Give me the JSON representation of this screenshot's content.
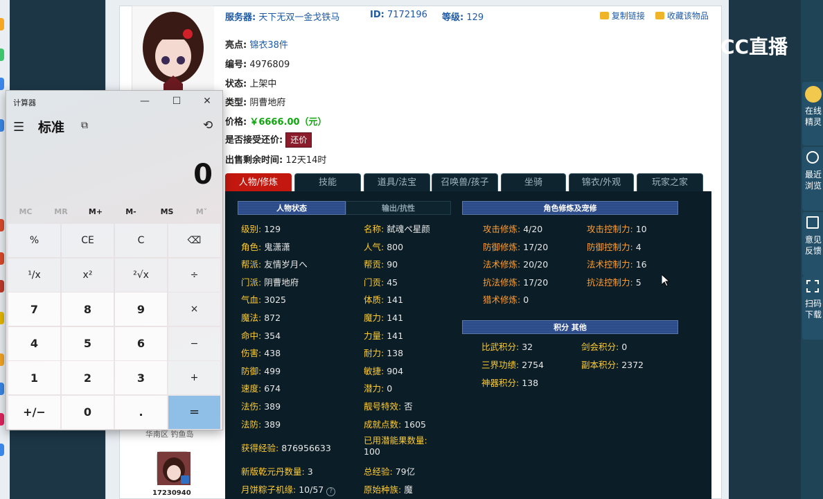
{
  "calculator": {
    "title": "计算器",
    "mode": "标准",
    "display": "0",
    "memory": [
      "MC",
      "MR",
      "M+",
      "M-",
      "MS",
      "M˅"
    ],
    "keys": [
      [
        "%",
        "CE",
        "C",
        "⌫"
      ],
      [
        "¹/x",
        "x²",
        "²√x",
        "÷"
      ],
      [
        "7",
        "8",
        "9",
        "×"
      ],
      [
        "4",
        "5",
        "6",
        "−"
      ],
      [
        "1",
        "2",
        "3",
        "+"
      ],
      [
        "+/−",
        "0",
        ".",
        "="
      ]
    ]
  },
  "info": {
    "server_label": "服务器:",
    "server_value": "天下无双一金戈铁马",
    "id_label": "ID:",
    "id_value": "7172196",
    "level_label": "等级:",
    "level_value": "129",
    "copy_link": "复制链接",
    "favorite": "收藏该物品",
    "highlight_label": "亮点:",
    "highlight_value": "锦衣38件",
    "number_label": "编号:",
    "number_value": "4976809",
    "status_label": "状态:",
    "status_value": "上架中",
    "type_label": "类型:",
    "type_value": "阴曹地府",
    "price_label": "价格:",
    "price_value": "￥6666.00（元）",
    "bargain_label": "是否接受还价:",
    "bargain_button": "还价",
    "remaining_label": "出售剩余时间:",
    "remaining_value": "12天14时"
  },
  "tabs": [
    "人物/修炼",
    "技能",
    "道具/法宝",
    "召唤兽/孩子",
    "坐骑",
    "锦衣/外观",
    "玩家之家"
  ],
  "headers": {
    "status": "人物状态",
    "output": "输出/抗性",
    "cultivation": "角色修炼及宠修",
    "points": "积分 其他"
  },
  "stats_left": [
    [
      "级别:",
      "129"
    ],
    [
      "角色:",
      "鬼潇潇"
    ],
    [
      "帮派:",
      "友情岁月へ"
    ],
    [
      "门派:",
      "阴曹地府"
    ],
    [
      "气血:",
      "3025"
    ],
    [
      "魔法:",
      "872"
    ],
    [
      "命中:",
      "354"
    ],
    [
      "伤害:",
      "438"
    ],
    [
      "防御:",
      "499"
    ],
    [
      "速度:",
      "674"
    ],
    [
      "法伤:",
      "389"
    ],
    [
      "法防:",
      "389"
    ]
  ],
  "stats_mid": [
    [
      "名称:",
      "弑魂ペ星颜"
    ],
    [
      "人气:",
      "800"
    ],
    [
      "帮贡:",
      "90"
    ],
    [
      "门贡:",
      "45"
    ],
    [
      "体质:",
      "141"
    ],
    [
      "魔力:",
      "141"
    ],
    [
      "力量:",
      "141"
    ],
    [
      "耐力:",
      "138"
    ],
    [
      "敏捷:",
      "904"
    ],
    [
      "潜力:",
      "0"
    ],
    [
      "靓号特效:",
      "否"
    ],
    [
      "成就点数:",
      "1605"
    ]
  ],
  "stats_bottom": {
    "exp_label": "获得经验:",
    "exp_value": "876956633",
    "used_fruit_label": "已用潜能果数量:",
    "used_fruit_value": "100",
    "pill_label": "新版乾元丹数量:",
    "pill_value": "3",
    "total_exp_label": "总经验:",
    "total_exp_value": "79亿",
    "zongzi_label": "月饼粽子机缘:",
    "zongzi_value": "10/57",
    "race_label": "原始种族:",
    "race_value": "魔"
  },
  "cultivation": [
    [
      "攻击修炼:",
      "4/20",
      "攻击控制力:",
      "10"
    ],
    [
      "防御修炼:",
      "17/20",
      "防御控制力:",
      "4"
    ],
    [
      "法术修炼:",
      "20/20",
      "法术控制力:",
      "16"
    ],
    [
      "抗法修炼:",
      "17/20",
      "抗法控制力:",
      "5"
    ],
    [
      "猎术修炼:",
      "0",
      "",
      ""
    ]
  ],
  "points": [
    [
      "比武积分:",
      "32",
      "剑会积分:",
      "0"
    ],
    [
      "三界功绩:",
      "2754",
      "副本积分:",
      "2372"
    ],
    [
      "神器积分:",
      "138",
      "",
      ""
    ]
  ],
  "side": {
    "region_text": "华南区 钓鱼岛",
    "user_id": "17230940"
  },
  "stream": {
    "logo": "CC直播"
  },
  "right_panel": [
    "在线精灵",
    "最近浏览",
    "意见反馈",
    "扫码下载"
  ],
  "colors": {
    "accent_red": "#c3180f",
    "price_green": "#10a60e",
    "label_yellow": "#ffcc33"
  }
}
